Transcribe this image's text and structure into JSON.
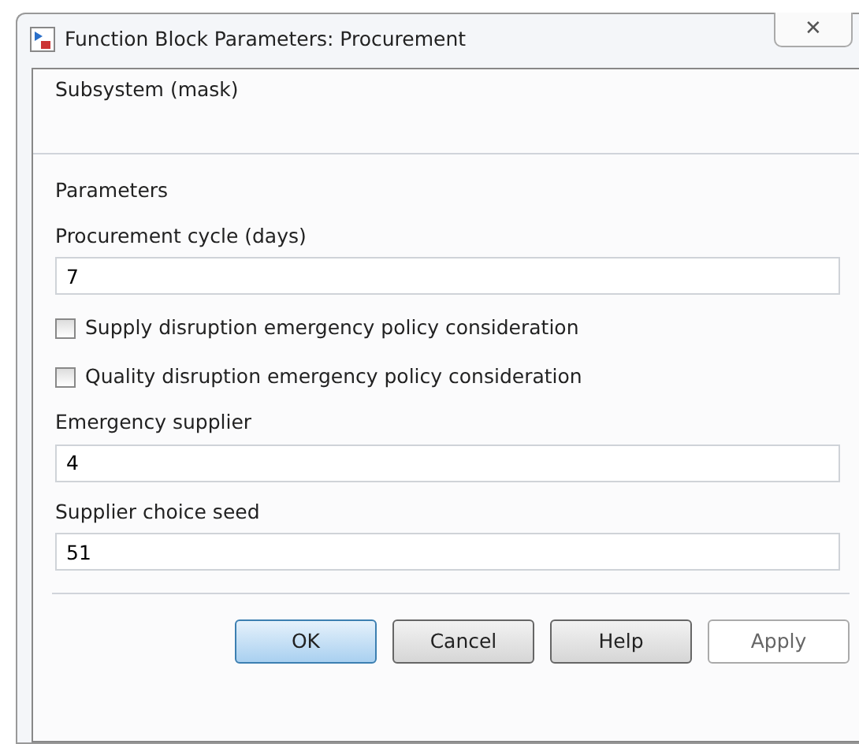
{
  "window": {
    "title": "Function Block Parameters: Procurement",
    "close": "✕"
  },
  "description": {
    "heading": "Subsystem (mask)"
  },
  "parameters": {
    "heading": "Parameters",
    "items": [
      {
        "kind": "field",
        "label": "Procurement cycle (days)",
        "value": "7"
      },
      {
        "kind": "checkbox",
        "label": "Supply disruption emergency policy consideration",
        "checked": false
      },
      {
        "kind": "checkbox",
        "label": "Quality disruption emergency policy consideration",
        "checked": false
      },
      {
        "kind": "field",
        "label": "Emergency supplier",
        "value": "4"
      },
      {
        "kind": "field",
        "label": "Supplier choice seed",
        "value": "51"
      }
    ]
  },
  "buttons": [
    {
      "label": "OK",
      "default": true,
      "disabled": false
    },
    {
      "label": "Cancel",
      "default": false,
      "disabled": false
    },
    {
      "label": "Help",
      "default": false,
      "disabled": false
    },
    {
      "label": "Apply",
      "default": false,
      "disabled": true
    }
  ]
}
